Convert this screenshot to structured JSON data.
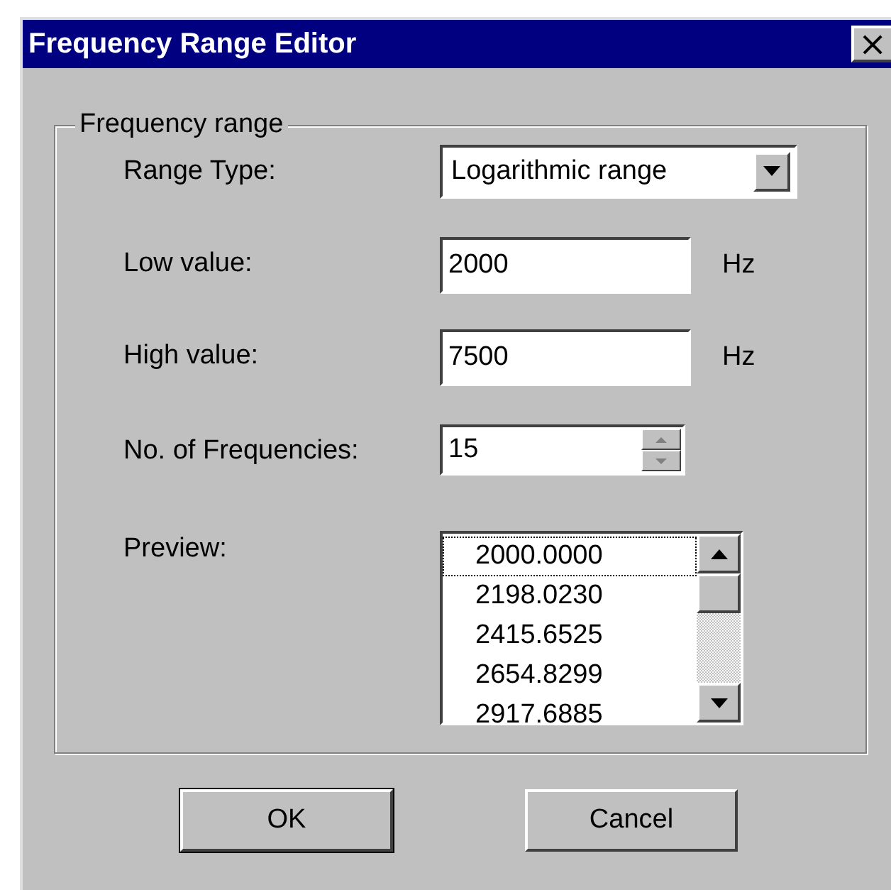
{
  "window": {
    "title": "Frequency Range Editor",
    "close": "×"
  },
  "group": {
    "title": "Frequency range"
  },
  "range_type": {
    "label": "Range Type:",
    "value": "Logarithmic range"
  },
  "low_value": {
    "label": "Low value:",
    "value": "2000",
    "unit": "Hz"
  },
  "high_value": {
    "label": "High value:",
    "value": "7500",
    "unit": "Hz"
  },
  "frequencies": {
    "label": "No. of Frequencies:",
    "value": "15"
  },
  "preview": {
    "label": "Preview:",
    "items": [
      {
        "text": "2000.0000",
        "selected": true
      },
      {
        "text": "2198.0230",
        "selected": false
      },
      {
        "text": "2415.6525",
        "selected": false
      },
      {
        "text": "2654.8299",
        "selected": false
      },
      {
        "text": "2917.6885",
        "selected": false
      }
    ]
  },
  "buttons": [
    {
      "label": "OK",
      "default": true
    },
    {
      "label": "Cancel",
      "default": false
    }
  ]
}
